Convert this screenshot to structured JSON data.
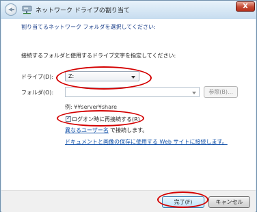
{
  "window": {
    "title": "ネットワーク ドライブの割り当て",
    "close_label": "X"
  },
  "intro": {
    "line1": "割り当てるネットワーク フォルダを選択してください:",
    "line2": "接続するフォルダと使用するドライブ文字を指定してください:"
  },
  "drive": {
    "label": "ドライブ(D):",
    "value": "Z:"
  },
  "folder": {
    "label": "フォルダ(O):",
    "value": "",
    "browse_label": "参照(B)..."
  },
  "example": "例: ¥¥server¥share",
  "reconnect": {
    "label": "ログオン時に再接続する(R)",
    "checked": true
  },
  "other_user": {
    "link": "異なるユーザー名",
    "suffix": "で接続します。"
  },
  "website_link": "ドキュメントと画像の保存に使用する Web サイトに接続します。",
  "footer": {
    "finish_label": "完了(F)",
    "cancel_label": "キャンセル"
  },
  "colors": {
    "highlight_oval": "#d40000",
    "link": "#0f4fa8"
  }
}
